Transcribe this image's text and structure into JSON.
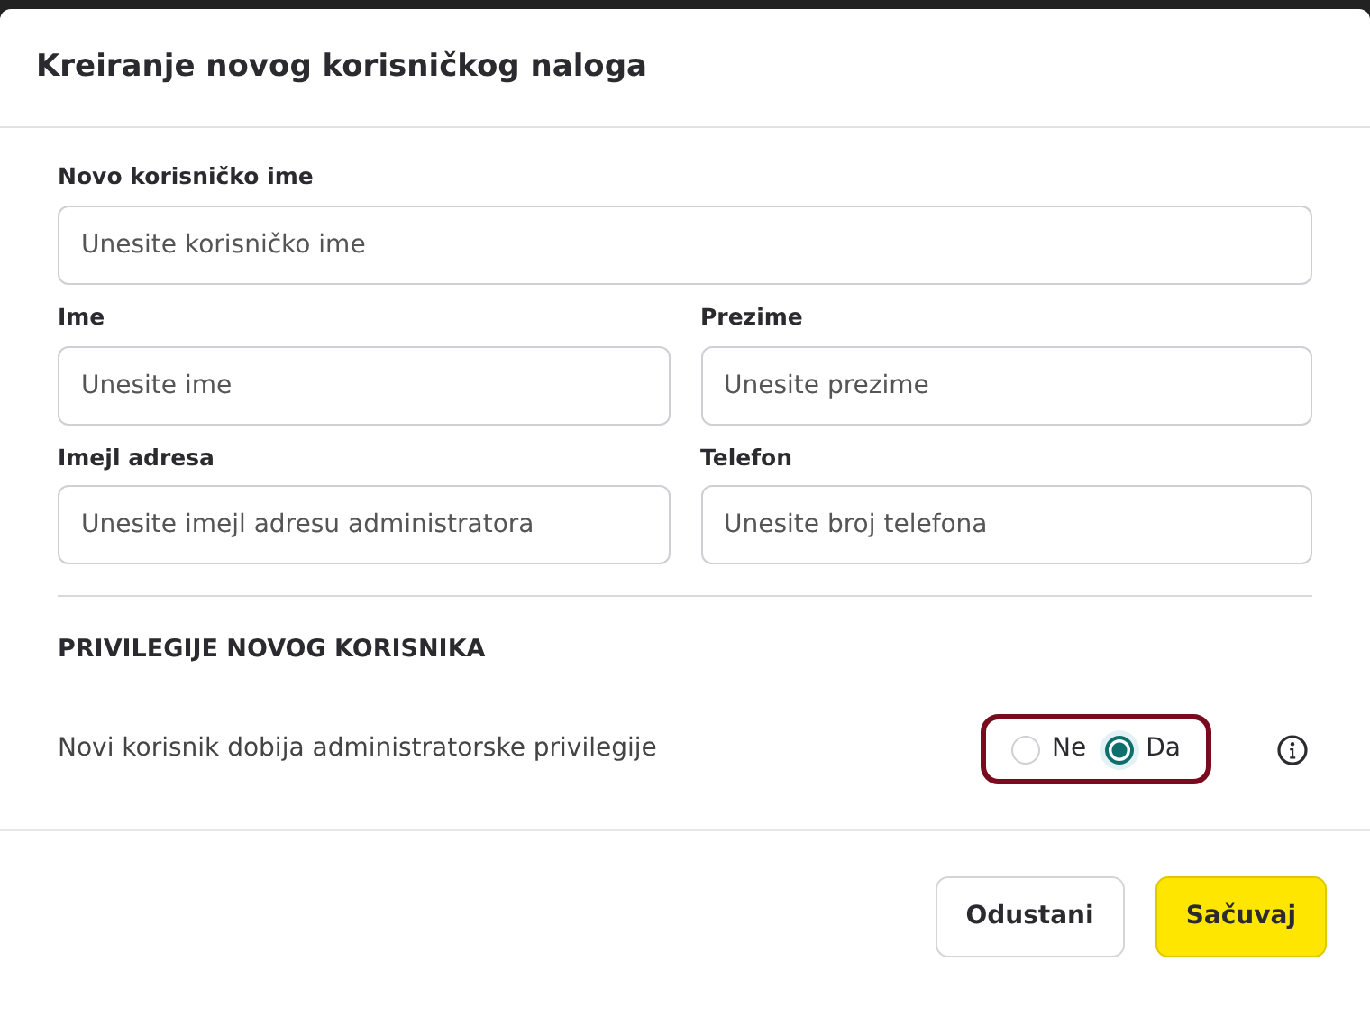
{
  "dialog": {
    "title": "Kreiranje novog korisničkog naloga"
  },
  "field_rows": [
    [
      {
        "label": "Novo korisničko ime",
        "placeholder": "Unesite korisničko ime"
      }
    ],
    [
      {
        "label": "Ime",
        "placeholder": "Unesite ime"
      },
      {
        "label": "Prezime",
        "placeholder": "Unesite prezime"
      }
    ],
    [
      {
        "label": "Imejl adresa",
        "placeholder": "Unesite imejl adresu administratora"
      },
      {
        "label": "Telefon",
        "placeholder": "Unesite broj telefona"
      }
    ]
  ],
  "privileges": {
    "heading": "PRIVILEGIJE NOVOG KORISNIKA",
    "question": "Novi korisnik dobija administratorske privilegije",
    "highlighted": true,
    "options": [
      {
        "label": "Ne",
        "selected": false
      },
      {
        "label": "Da",
        "selected": true
      }
    ]
  },
  "buttons": [
    {
      "label": "Odustani",
      "kind": "secondary"
    },
    {
      "label": "Sačuvaj",
      "kind": "primary"
    }
  ]
}
